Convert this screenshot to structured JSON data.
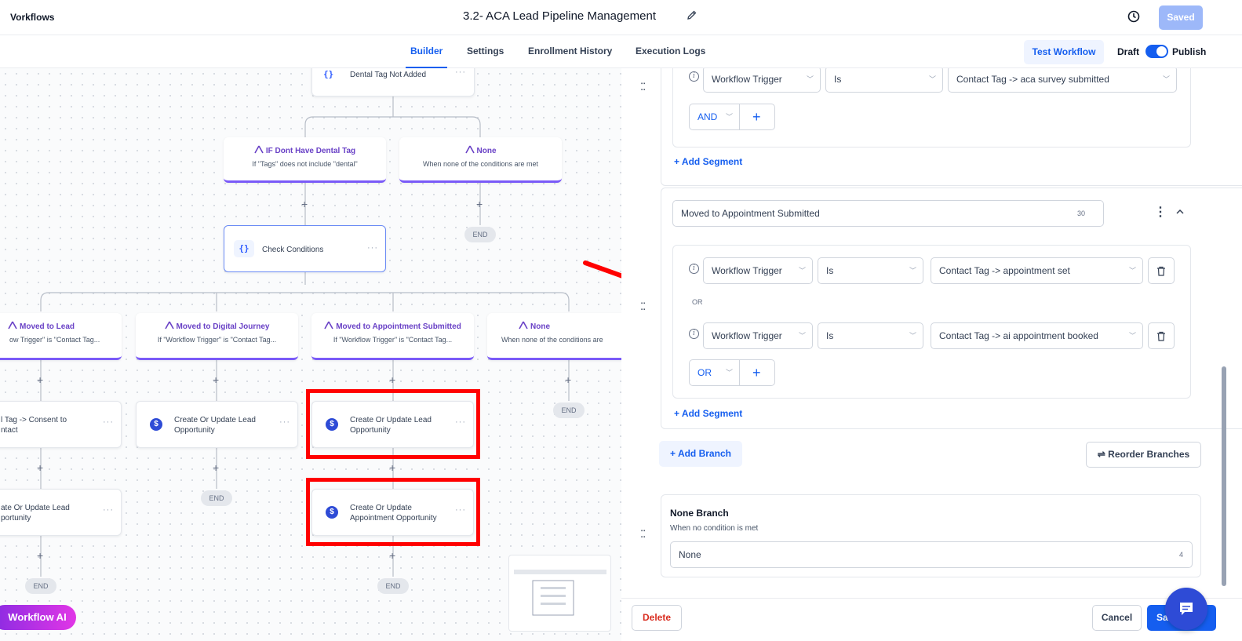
{
  "header": {
    "app_label": "Vorkflows",
    "workflow_title": "3.2- ACA Lead Pipeline Management",
    "saved_label": "Saved"
  },
  "tabs": [
    {
      "label": "Builder",
      "active": true
    },
    {
      "label": "Settings"
    },
    {
      "label": "Enrollment History"
    },
    {
      "label": "Execution Logs"
    }
  ],
  "toolbar": {
    "test_label": "Test Workflow",
    "draft_label": "Draft",
    "publish_label": "Publish",
    "publish_toggle_on": true
  },
  "canvas": {
    "top_node": "Dental Tag Not Added",
    "branch_dental": {
      "title": "IF Dont Have Dental Tag",
      "sub": "If \"Tags\" does not include \"dental\""
    },
    "branch_none_1": {
      "title": "None",
      "sub": "When none of the conditions are met"
    },
    "check_conditions": "Check Conditions",
    "branch_lead": {
      "title": "Moved to Lead",
      "sub": "ow Trigger\" is \"Contact Tag..."
    },
    "branch_digital": {
      "title": "Moved to Digital Journey",
      "sub": "If \"Workflow Trigger\" is \"Contact Tag..."
    },
    "branch_appt": {
      "title": "Moved to Appointment Submitted",
      "sub": "If \"Workflow Trigger\" is \"Contact Tag..."
    },
    "branch_none_2": {
      "title": "None",
      "sub": "When none of the conditions are"
    },
    "action_consent": {
      "line1": "l Tag -> Consent to",
      "line2": "ntact"
    },
    "action_digital": {
      "line1": "Create Or Update Lead",
      "line2": "Opportunity"
    },
    "action_appt": {
      "line1": "Create Or Update Lead",
      "line2": "Opportunity"
    },
    "action_lead2": {
      "line1": "ate Or Update Lead",
      "line2": "portunity"
    },
    "action_appt2": {
      "line1": "Create Or Update",
      "line2": "Appointment Opportunity"
    },
    "end_label": "END",
    "ai_button": "Workflow AI"
  },
  "panel": {
    "segment1": {
      "field": "Workflow Trigger",
      "operator": "Is",
      "value": "Contact Tag -> aca survey submitted",
      "join": "AND"
    },
    "add_segment": "Add Segment",
    "branch2": {
      "name": "Moved to Appointment Submitted",
      "char_count": "30",
      "conditions": [
        {
          "field": "Workflow Trigger",
          "operator": "Is",
          "value": "Contact Tag -> appointment set"
        },
        {
          "field": "Workflow Trigger",
          "operator": "Is",
          "value": "Contact Tag -> ai appointment booked"
        }
      ],
      "or_separator": "OR",
      "join": "OR"
    },
    "add_branch": "Add Branch",
    "reorder": "Reorder Branches",
    "none_branch": {
      "title": "None Branch",
      "sub": "When no condition is met",
      "value": "None",
      "char_count": "4"
    },
    "delete_label": "Delete",
    "cancel_label": "Cancel",
    "save_label": "Sa"
  },
  "colors": {
    "primary": "#155eef",
    "purple": "#7a5af8",
    "annotation_red": "#ff0000",
    "ai_pink": "#d02ff0"
  }
}
